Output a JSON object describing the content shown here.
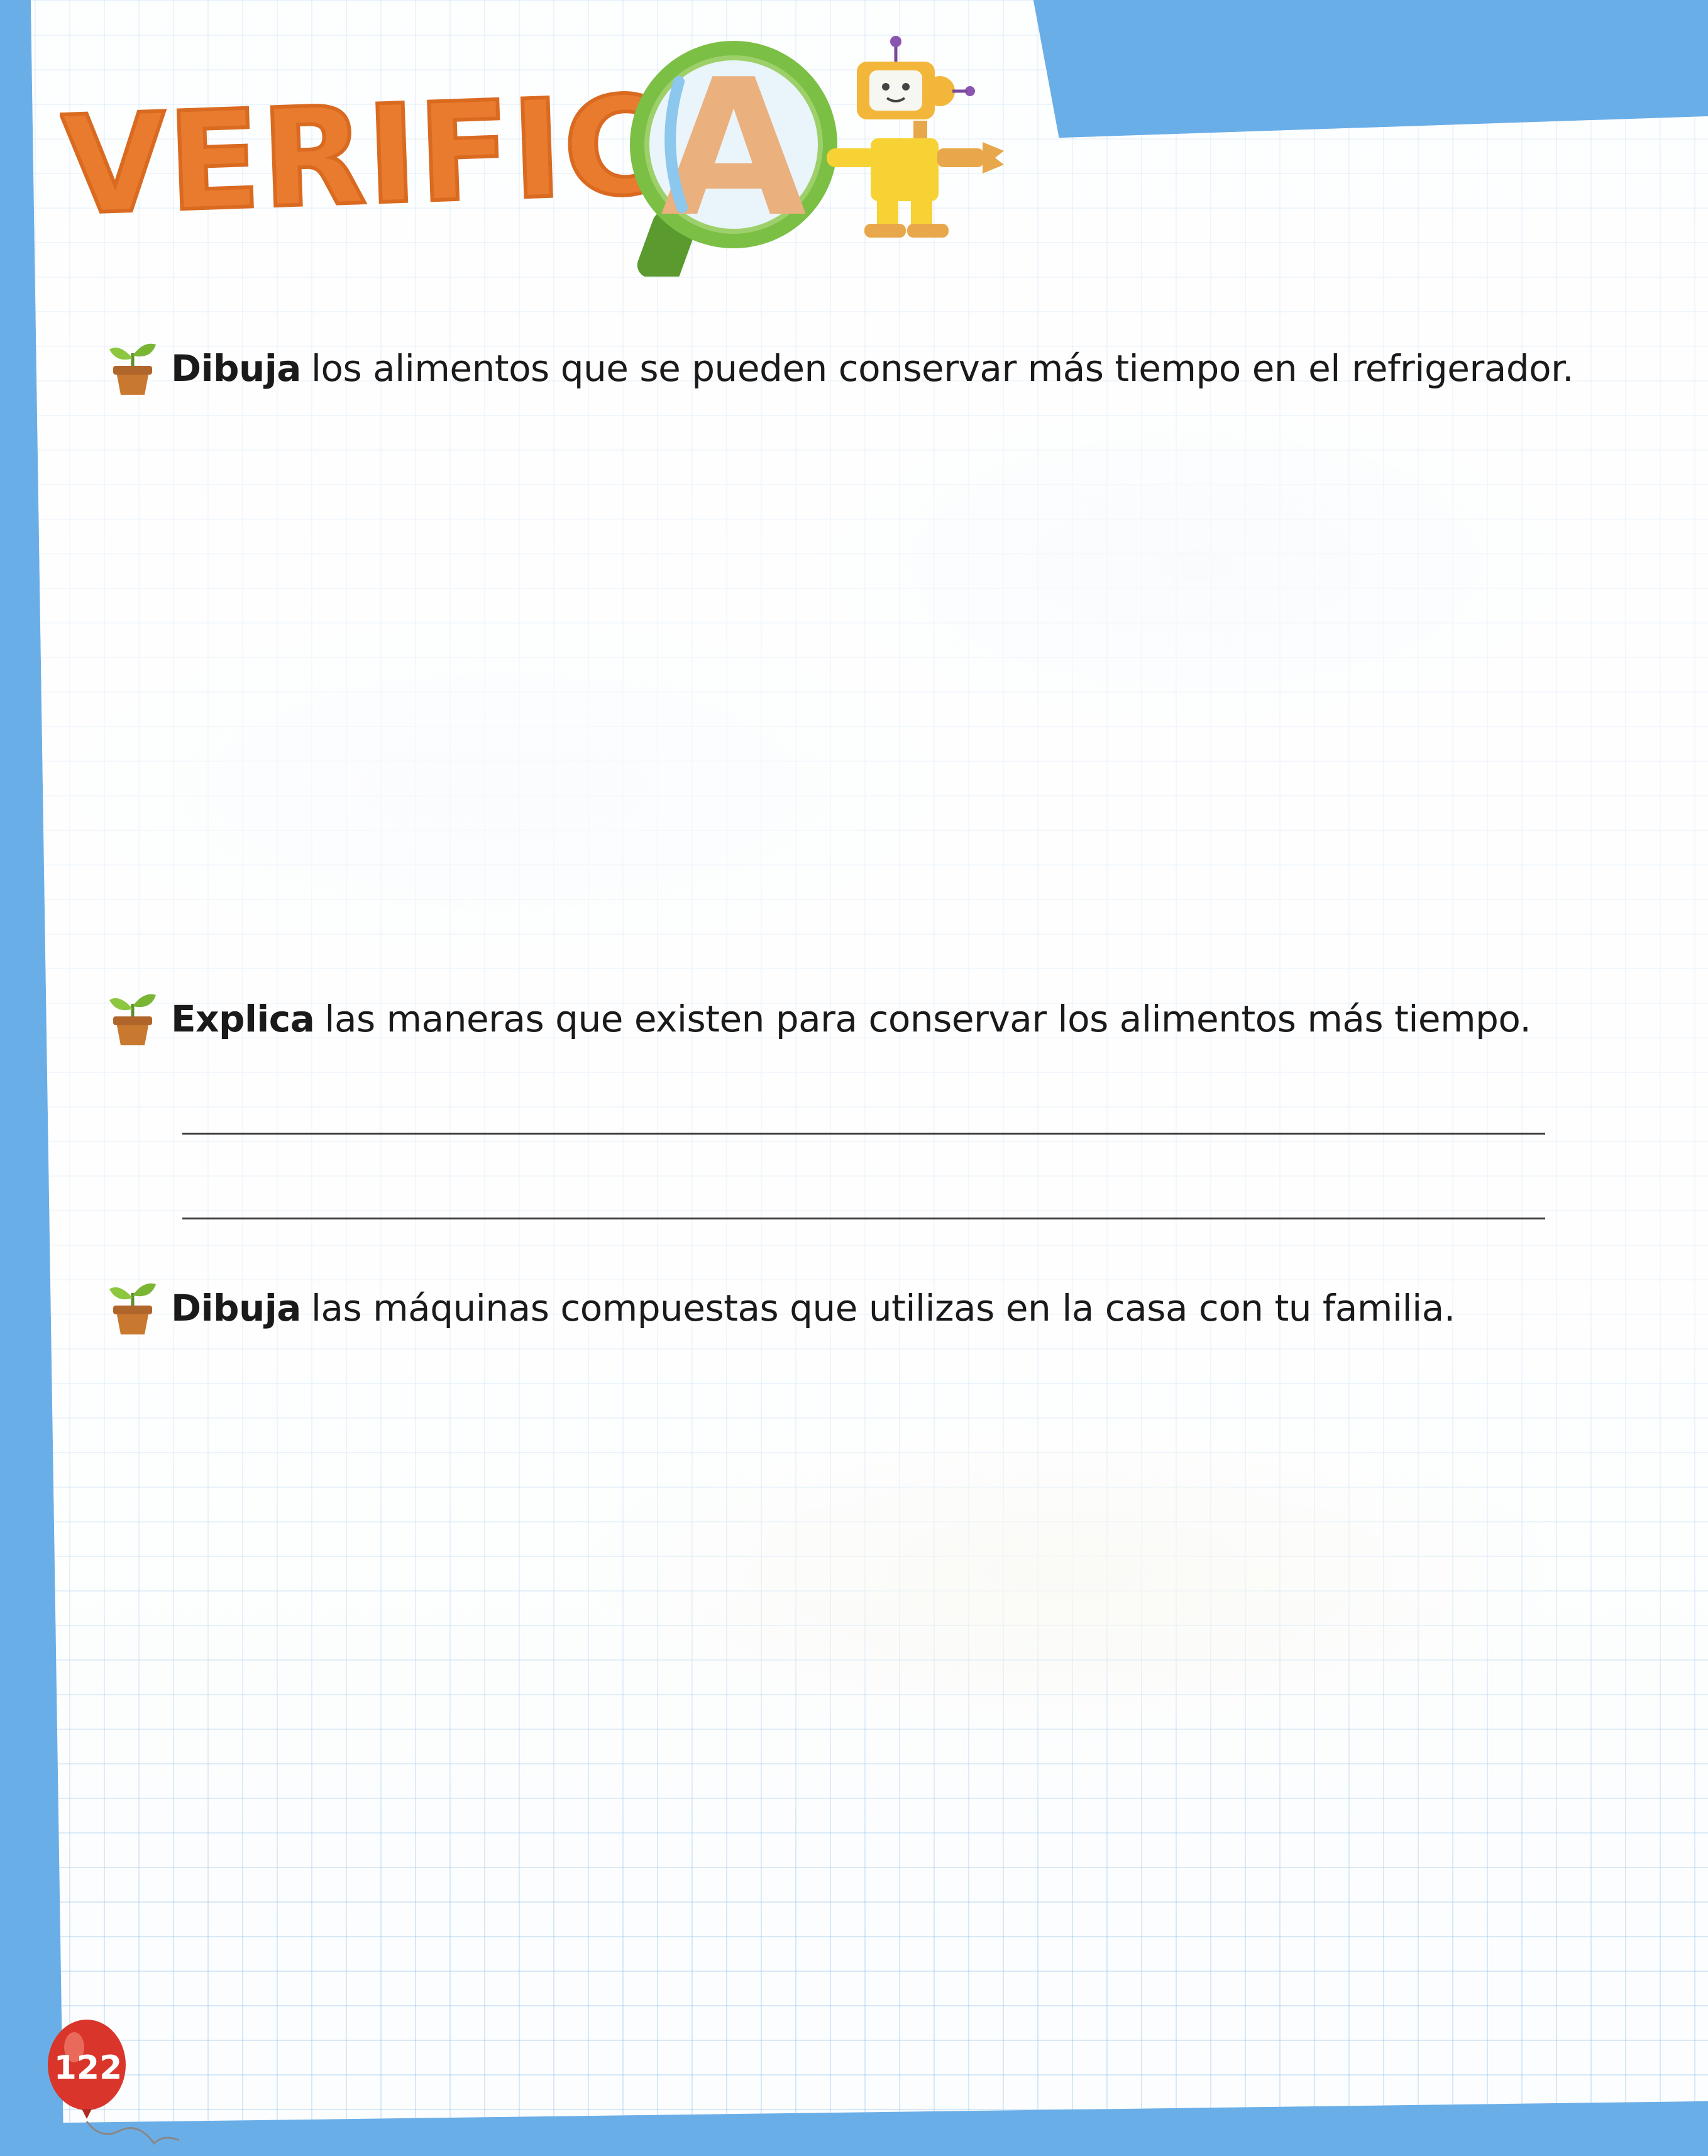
{
  "header": {
    "title_letters": "VERIFIC",
    "title_magnified_letter": "A",
    "icon_names": [
      "magnifying-glass-icon",
      "robot-icon"
    ]
  },
  "questions": [
    {
      "verb": "Dibuja",
      "text": "los alimentos que se pueden conservar más tiempo en el refrigerador.",
      "icon": "sprout-pot-icon"
    },
    {
      "verb": "Explica",
      "text": "las maneras que existen para conservar los alimentos más tiempo.",
      "icon": "sprout-pot-icon"
    },
    {
      "verb": "Dibuja",
      "text": "las máquinas compuestas que utilizas en la casa con tu familia.",
      "icon": "sprout-pot-icon"
    }
  ],
  "footer": {
    "page_number": "122",
    "badge_icon": "balloon-icon"
  },
  "colors": {
    "title_orange": "#e97b2e",
    "magnifier_green": "#7bbf44",
    "frame_blue": "#6aaee8",
    "balloon_red": "#d9352a"
  }
}
